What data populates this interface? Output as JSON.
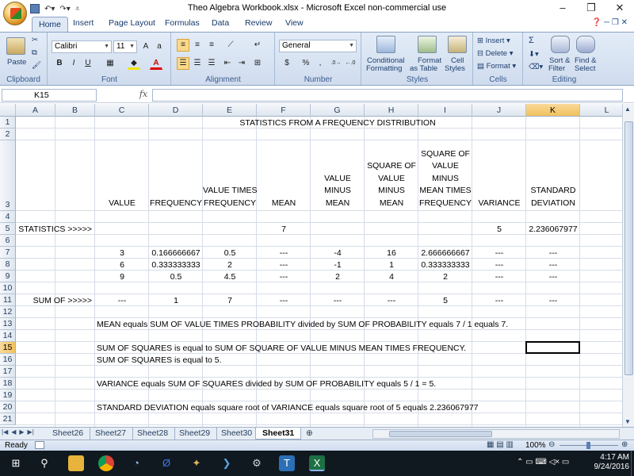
{
  "window": {
    "title": "Theo Algebra Workbook.xlsx - Microsoft Excel non-commercial use",
    "controls": [
      "–",
      "❐",
      "✕"
    ]
  },
  "ribbon_tabs": [
    "Home",
    "Insert",
    "Page Layout",
    "Formulas",
    "Data",
    "Review",
    "View"
  ],
  "ribbon": {
    "clipboard": {
      "label": "Clipboard",
      "paste": "Paste"
    },
    "font": {
      "label": "Font",
      "name": "Calibri",
      "size": "11",
      "bold": "B",
      "italic": "I",
      "underline": "U"
    },
    "alignment": {
      "label": "Alignment"
    },
    "number": {
      "label": "Number",
      "format": "General",
      "currency": "$",
      "percent": "%",
      "comma": ","
    },
    "styles": {
      "label": "Styles",
      "conditional": "Conditional Formatting",
      "cond_line1": "Conditional",
      "cond_line2": "Formatting",
      "table_line1": "Format",
      "table_line2": "as Table",
      "cell_line1": "Cell",
      "cell_line2": "Styles"
    },
    "cells": {
      "label": "Cells",
      "insert": "Insert",
      "delete": "Delete",
      "format": "Format"
    },
    "editing": {
      "label": "Editing",
      "sigma": "Σ",
      "sort_line1": "Sort &",
      "sort_line2": "Filter",
      "find_line1": "Find &",
      "find_line2": "Select"
    }
  },
  "formula_bar": {
    "name_box": "K15",
    "fx": "fx",
    "content": ""
  },
  "columns": [
    "A",
    "B",
    "C",
    "D",
    "E",
    "F",
    "G",
    "H",
    "I",
    "J",
    "K",
    "L"
  ],
  "selected_cell": "K15",
  "rows": [
    "1",
    "2",
    "3",
    "4",
    "5",
    "6",
    "7",
    "8",
    "9",
    "10",
    "11",
    "12",
    "13",
    "14",
    "15",
    "16",
    "17",
    "18",
    "19",
    "20",
    "21"
  ],
  "sheet": {
    "title": "STATISTICS FROM A FREQUENCY DISTRIBUTION",
    "headers": {
      "C": [
        "VALUE"
      ],
      "D": [
        "FREQUENCY"
      ],
      "E": [
        "VALUE TIMES",
        "FREQUENCY"
      ],
      "F": [
        "MEAN"
      ],
      "G": [
        "VALUE",
        "MINUS",
        "MEAN"
      ],
      "H": [
        "SQUARE OF",
        "VALUE",
        "MINUS",
        "MEAN"
      ],
      "I": [
        "SQUARE OF",
        "VALUE",
        "MINUS",
        "MEAN TIMES",
        "FREQUENCY"
      ],
      "J": [
        "VARIANCE"
      ],
      "K": [
        "STANDARD",
        "DEVIATION"
      ]
    },
    "stats_row": {
      "label": "STATISTICS >>>>>",
      "mean": "7",
      "variance": "5",
      "stdev": "2.236067977"
    },
    "data_rows": [
      [
        "3",
        "0.166666667",
        "0.5",
        "---",
        "-4",
        "16",
        "2.666666667",
        "---",
        "---"
      ],
      [
        "6",
        "0.333333333",
        "2",
        "---",
        "-1",
        "1",
        "0.333333333",
        "---",
        "---"
      ],
      [
        "9",
        "0.5",
        "4.5",
        "---",
        "2",
        "4",
        "2",
        "---",
        "---"
      ]
    ],
    "sum_row": {
      "label": "SUM OF >>>>>",
      "values": [
        "---",
        "1",
        "7",
        "---",
        "---",
        "---",
        "5",
        "---",
        "---"
      ]
    },
    "notes": {
      "r13": "MEAN equals SUM OF VALUE TIMES PROBABILITY divided by SUM OF PROBABILITY equals 7 / 1  equals 7.",
      "r15": "SUM OF SQUARES is equal to SUM OF SQUARE OF VALUE MINUS MEAN TIMES FREQUENCY.",
      "r16": "SUM OF SQUARES is equal to 5.",
      "r18": "VARIANCE equals SUM OF SQUARES divided by SUM OF PROBABILITY equals 5 / 1 = 5.",
      "r20": "STANDARD DEVIATION equals square root of VARIANCE equals square root of 5 equals 2.236067977"
    }
  },
  "sheet_tabs": [
    "Sheet26",
    "Sheet27",
    "Sheet28",
    "Sheet29",
    "Sheet30",
    "Sheet31"
  ],
  "active_sheet": "Sheet31",
  "status": {
    "ready": "Ready",
    "zoom": "100%"
  },
  "taskbar": {
    "time": "4:17 AM",
    "date": "9/24/2016"
  }
}
